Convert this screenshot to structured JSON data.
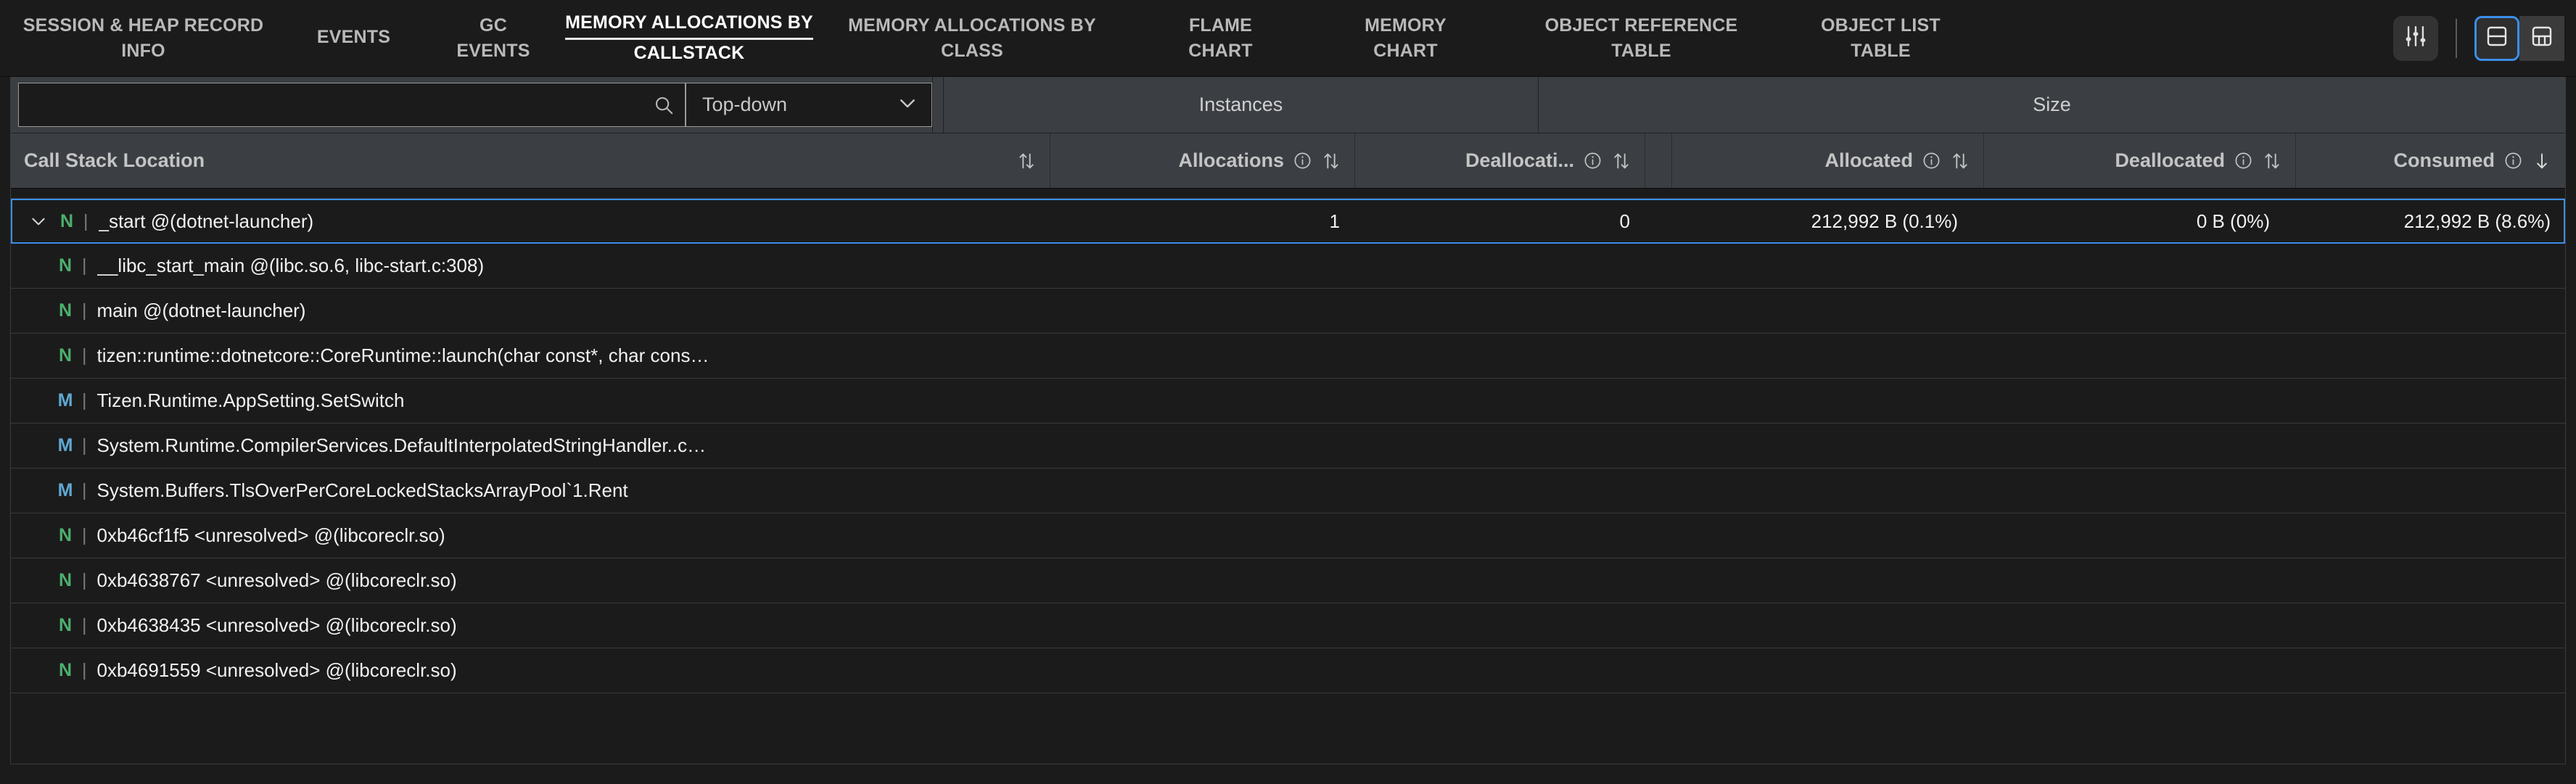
{
  "tabs": [
    {
      "key": "session-heap-record-info",
      "l1": "SESSION & HEAP RECORD",
      "l2": "INFO",
      "active": false
    },
    {
      "key": "events",
      "l1": "EVENTS",
      "l2": "",
      "active": false
    },
    {
      "key": "gc-events",
      "l1": "GC",
      "l2": "EVENTS",
      "active": false
    },
    {
      "key": "memory-allocations-by-callstack",
      "l1": "MEMORY ALLOCATIONS BY",
      "l2": "CALLSTACK",
      "active": true
    },
    {
      "key": "memory-allocations-by-class",
      "l1": "MEMORY ALLOCATIONS BY",
      "l2": "CLASS",
      "active": false
    },
    {
      "key": "flame-chart",
      "l1": "FLAME",
      "l2": "CHART",
      "active": false
    },
    {
      "key": "memory-chart",
      "l1": "MEMORY",
      "l2": "CHART",
      "active": false
    },
    {
      "key": "object-reference-table",
      "l1": "OBJECT REFERENCE",
      "l2": "TABLE",
      "active": false
    },
    {
      "key": "object-list-table",
      "l1": "OBJECT LIST",
      "l2": "TABLE",
      "active": false
    }
  ],
  "toolbar": {
    "settings_icon": "sliders-icon",
    "layout_single_icon": "split-horizontal-icon",
    "layout_split_icon": "split-grid-icon",
    "selected_layout": "split-horizontal-icon",
    "accent_color": "#3b8eea"
  },
  "filter": {
    "search_value": "",
    "search_placeholder": "",
    "search_icon": "search-icon",
    "mode_value": "Top-down",
    "mode_chevron": "chevron-down-icon",
    "group_instances": "Instances",
    "group_size": "Size"
  },
  "columns": {
    "location": {
      "label": "Call Stack Location",
      "sort": "unsorted"
    },
    "allocations": {
      "label": "Allocations",
      "info": "info-icon",
      "sort": "unsorted"
    },
    "deallocations": {
      "label": "Deallocati...",
      "info": "info-icon",
      "sort": "unsorted"
    },
    "allocated": {
      "label": "Allocated",
      "info": "info-icon",
      "sort": "unsorted"
    },
    "deallocated": {
      "label": "Deallocated",
      "info": "info-icon",
      "sort": "unsorted"
    },
    "consumed": {
      "label": "Consumed",
      "info": "info-icon",
      "sort": "desc"
    }
  },
  "rows": [
    {
      "partial": true,
      "selected": false,
      "expander": "",
      "badge": "",
      "badge_type": "",
      "name": "",
      "allocations": "",
      "deallocations": "",
      "allocated": "",
      "deallocated": "",
      "consumed": ""
    },
    {
      "partial": false,
      "selected": true,
      "expander": "chevron-down-icon",
      "badge": "N",
      "badge_type": "n",
      "name": "_start @(dotnet-launcher)",
      "allocations": "1",
      "deallocations": "0",
      "allocated": "212,992 B (0.1%)",
      "deallocated": "0 B (0%)",
      "consumed": "212,992 B (8.6%)"
    },
    {
      "partial": false,
      "selected": false,
      "expander": "",
      "badge": "N",
      "badge_type": "n",
      "name": "__libc_start_main @(libc.so.6, libc-start.c:308)",
      "allocations": "",
      "deallocations": "",
      "allocated": "",
      "deallocated": "",
      "consumed": ""
    },
    {
      "partial": false,
      "selected": false,
      "expander": "",
      "badge": "N",
      "badge_type": "n",
      "name": "main @(dotnet-launcher)",
      "allocations": "",
      "deallocations": "",
      "allocated": "",
      "deallocated": "",
      "consumed": ""
    },
    {
      "partial": false,
      "selected": false,
      "expander": "",
      "badge": "N",
      "badge_type": "n",
      "name": "tizen::runtime::dotnetcore::CoreRuntime::launch(char const*, char cons…",
      "allocations": "",
      "deallocations": "",
      "allocated": "",
      "deallocated": "",
      "consumed": ""
    },
    {
      "partial": false,
      "selected": false,
      "expander": "",
      "badge": "M",
      "badge_type": "m",
      "name": "Tizen.Runtime.AppSetting.SetSwitch",
      "allocations": "",
      "deallocations": "",
      "allocated": "",
      "deallocated": "",
      "consumed": ""
    },
    {
      "partial": false,
      "selected": false,
      "expander": "",
      "badge": "M",
      "badge_type": "m",
      "name": "System.Runtime.CompilerServices.DefaultInterpolatedStringHandler..c…",
      "allocations": "",
      "deallocations": "",
      "allocated": "",
      "deallocated": "",
      "consumed": ""
    },
    {
      "partial": false,
      "selected": false,
      "expander": "",
      "badge": "M",
      "badge_type": "m",
      "name": "System.Buffers.TlsOverPerCoreLockedStacksArrayPool`1.Rent",
      "allocations": "",
      "deallocations": "",
      "allocated": "",
      "deallocated": "",
      "consumed": ""
    },
    {
      "partial": false,
      "selected": false,
      "expander": "",
      "badge": "N",
      "badge_type": "n",
      "name": "0xb46cf1f5 <unresolved> @(libcoreclr.so)",
      "allocations": "",
      "deallocations": "",
      "allocated": "",
      "deallocated": "",
      "consumed": ""
    },
    {
      "partial": false,
      "selected": false,
      "expander": "",
      "badge": "N",
      "badge_type": "n",
      "name": "0xb4638767 <unresolved> @(libcoreclr.so)",
      "allocations": "",
      "deallocations": "",
      "allocated": "",
      "deallocated": "",
      "consumed": ""
    },
    {
      "partial": false,
      "selected": false,
      "expander": "",
      "badge": "N",
      "badge_type": "n",
      "name": "0xb4638435 <unresolved> @(libcoreclr.so)",
      "allocations": "",
      "deallocations": "",
      "allocated": "",
      "deallocated": "",
      "consumed": ""
    },
    {
      "partial": false,
      "selected": false,
      "expander": "",
      "badge": "N",
      "badge_type": "n",
      "name": "0xb4691559 <unresolved> @(libcoreclr.so)",
      "allocations": "",
      "deallocations": "",
      "allocated": "",
      "deallocated": "",
      "consumed": ""
    }
  ]
}
